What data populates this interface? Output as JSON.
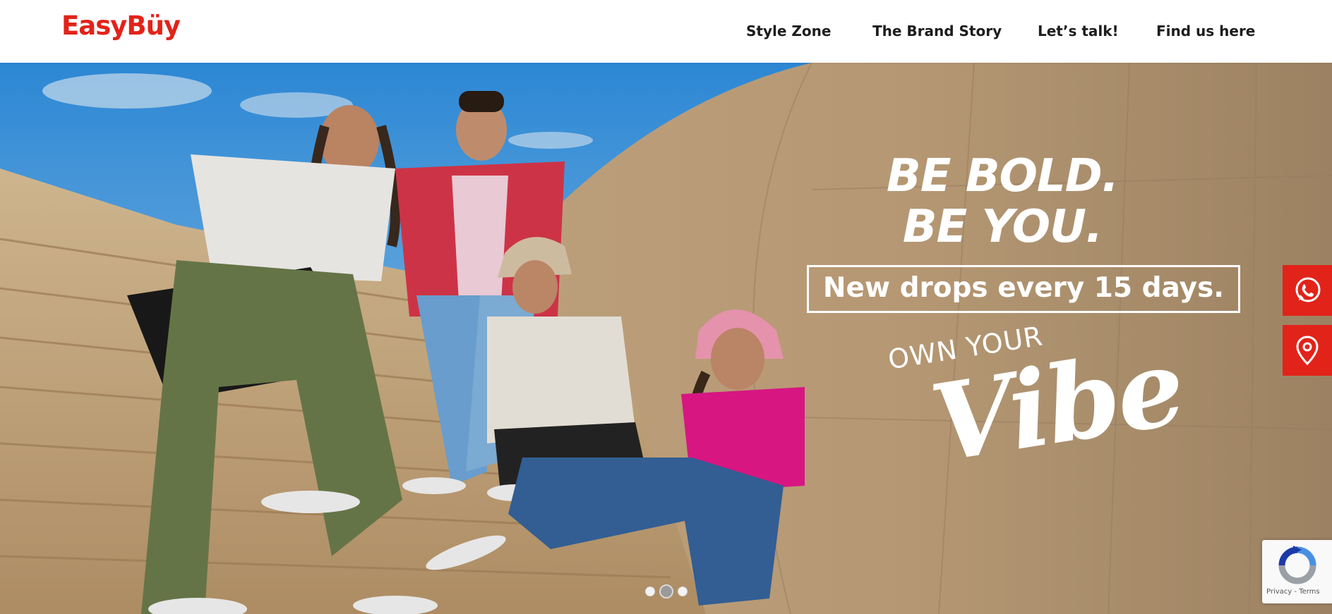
{
  "header": {
    "logo_text": "EasyBüy",
    "nav": [
      {
        "label": "Style Zone"
      },
      {
        "label": "The Brand Story"
      },
      {
        "label": "Let’s talk!"
      },
      {
        "label": "Find us here"
      }
    ]
  },
  "hero": {
    "headline_line1": "BE BOLD.",
    "headline_line2": "BE YOU.",
    "tagline": "New drops every 15 days.",
    "own_your": "OWN YOUR",
    "vibe": "Vibe"
  },
  "side_buttons": [
    {
      "icon": "whatsapp-icon"
    },
    {
      "icon": "location-pin-icon"
    }
  ],
  "carousel": {
    "slide_count": 3,
    "active_index": 1
  },
  "recaptcha": {
    "privacy": "Privacy",
    "separator": " - ",
    "terms": "Terms"
  },
  "colors": {
    "brand_red": "#e2231a",
    "nav_text": "#1d1d1d",
    "hero_text": "#ffffff"
  }
}
